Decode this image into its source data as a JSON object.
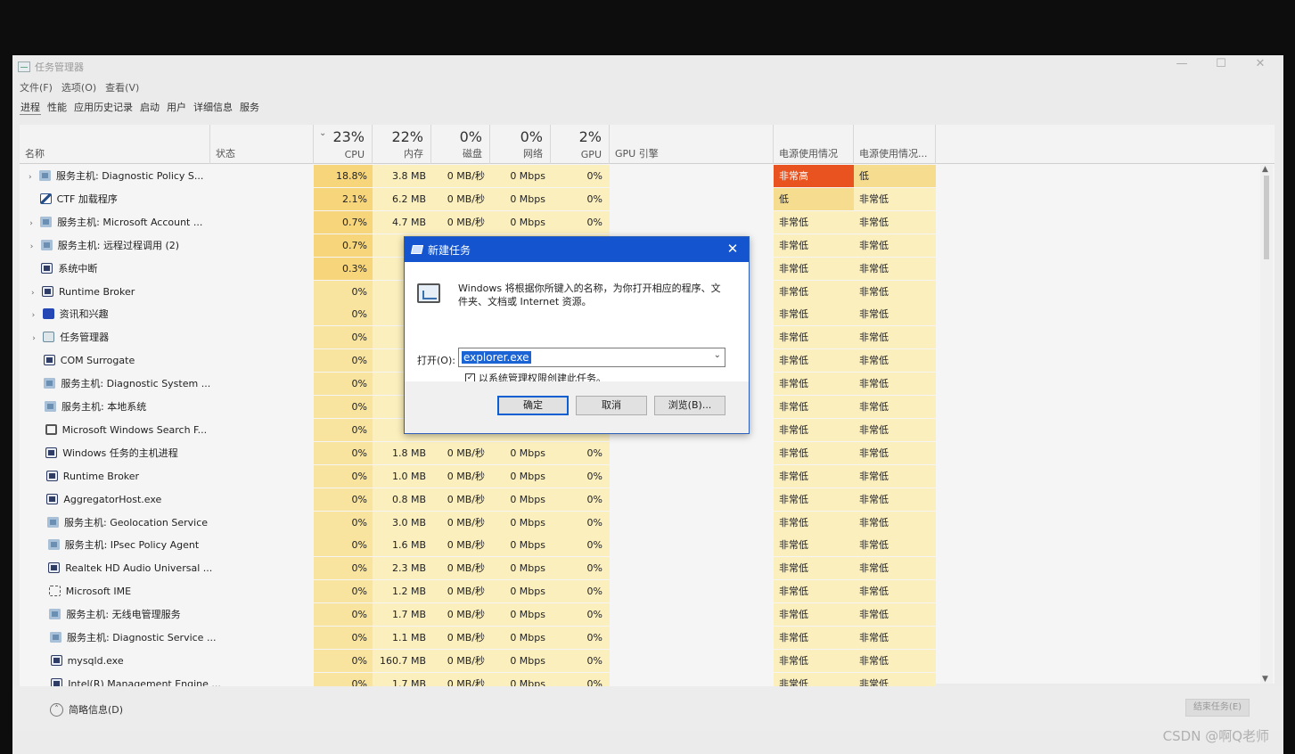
{
  "window": {
    "title": "任务管理器",
    "controls": [
      "—",
      "☐",
      "✕"
    ]
  },
  "menu": [
    "文件(F)",
    "选项(O)",
    "查看(V)"
  ],
  "tabs": [
    "进程",
    "性能",
    "应用历史记录",
    "启动",
    "用户",
    "详细信息",
    "服务"
  ],
  "columns": {
    "name": "名称",
    "status": "状态",
    "cpu": {
      "pct": "23%",
      "label": "CPU"
    },
    "mem": {
      "pct": "22%",
      "label": "内存"
    },
    "disk": {
      "pct": "0%",
      "label": "磁盘"
    },
    "net": {
      "pct": "0%",
      "label": "网络"
    },
    "gpu": {
      "pct": "2%",
      "label": "GPU"
    },
    "gpu_engine": "GPU 引擎",
    "power": "电源使用情况",
    "power_trend": "电源使用情况..."
  },
  "rows": [
    {
      "name": "服务主机: Diagnostic Policy S...",
      "exp": "›",
      "icon": "gear-icon",
      "cpu": "18.8%",
      "mem": "3.8 MB",
      "disk": "0 MB/秒",
      "net": "0 Mbps",
      "gpu": "0%",
      "pw": "非常高",
      "pw2": "低"
    },
    {
      "name": "CTF 加载程序",
      "exp": "",
      "icon": "pen-icon",
      "cpu": "2.1%",
      "mem": "6.2 MB",
      "disk": "0 MB/秒",
      "net": "0 Mbps",
      "gpu": "0%",
      "pw": "低",
      "pw2": "非常低"
    },
    {
      "name": "服务主机: Microsoft Account ...",
      "exp": "›",
      "icon": "gear-icon",
      "cpu": "0.7%",
      "mem": "4.7 MB",
      "disk": "0 MB/秒",
      "net": "0 Mbps",
      "gpu": "0%",
      "pw": "非常低",
      "pw2": "非常低"
    },
    {
      "name": "服务主机: 远程过程调用 (2)",
      "exp": "›",
      "icon": "gear-icon",
      "cpu": "0.7%",
      "mem": "5.",
      "disk": "",
      "net": "",
      "gpu": "",
      "pw": "非常低",
      "pw2": "非常低"
    },
    {
      "name": "系统中断",
      "exp": "",
      "icon": "window-icon",
      "cpu": "0.3%",
      "mem": "(",
      "disk": "",
      "net": "",
      "gpu": "",
      "pw": "非常低",
      "pw2": "非常低"
    },
    {
      "name": "Runtime Broker",
      "exp": "›",
      "icon": "window-icon",
      "cpu": "0%",
      "mem": "2.",
      "disk": "",
      "net": "",
      "gpu": "",
      "pw": "非常低",
      "pw2": "非常低"
    },
    {
      "name": "资讯和兴趣",
      "exp": "›",
      "icon": "news-icon",
      "cpu": "0%",
      "mem": "(",
      "disk": "",
      "net": "",
      "gpu": "",
      "pw": "非常低",
      "pw2": "非常低"
    },
    {
      "name": "任务管理器",
      "exp": "›",
      "icon": "task-manager-icon",
      "cpu": "0%",
      "mem": "23.",
      "disk": "",
      "net": "",
      "gpu": "",
      "pw": "非常低",
      "pw2": "非常低"
    },
    {
      "name": "COM Surrogate",
      "exp": "",
      "icon": "window-icon",
      "cpu": "0%",
      "mem": "1.",
      "disk": "",
      "net": "",
      "gpu": "",
      "pw": "非常低",
      "pw2": "非常低"
    },
    {
      "name": "服务主机: Diagnostic System ...",
      "exp": "",
      "icon": "gear-icon",
      "cpu": "0%",
      "mem": "1.",
      "disk": "",
      "net": "",
      "gpu": "",
      "pw": "非常低",
      "pw2": "非常低"
    },
    {
      "name": "服务主机: 本地系统",
      "exp": "",
      "icon": "gear-icon",
      "cpu": "0%",
      "mem": "1.",
      "disk": "",
      "net": "",
      "gpu": "",
      "pw": "非常低",
      "pw2": "非常低"
    },
    {
      "name": "Microsoft Windows Search F...",
      "exp": "",
      "icon": "search-icon",
      "cpu": "0%",
      "mem": "1.",
      "disk": "",
      "net": "",
      "gpu": "",
      "pw": "非常低",
      "pw2": "非常低"
    },
    {
      "name": "Windows 任务的主机进程",
      "exp": "",
      "icon": "window-icon",
      "cpu": "0%",
      "mem": "1.8 MB",
      "disk": "0 MB/秒",
      "net": "0 Mbps",
      "gpu": "0%",
      "pw": "非常低",
      "pw2": "非常低"
    },
    {
      "name": "Runtime Broker",
      "exp": "",
      "icon": "window-icon",
      "cpu": "0%",
      "mem": "1.0 MB",
      "disk": "0 MB/秒",
      "net": "0 Mbps",
      "gpu": "0%",
      "pw": "非常低",
      "pw2": "非常低"
    },
    {
      "name": "AggregatorHost.exe",
      "exp": "",
      "icon": "window-icon",
      "cpu": "0%",
      "mem": "0.8 MB",
      "disk": "0 MB/秒",
      "net": "0 Mbps",
      "gpu": "0%",
      "pw": "非常低",
      "pw2": "非常低"
    },
    {
      "name": "服务主机: Geolocation Service",
      "exp": "",
      "icon": "gear-icon",
      "cpu": "0%",
      "mem": "3.0 MB",
      "disk": "0 MB/秒",
      "net": "0 Mbps",
      "gpu": "0%",
      "pw": "非常低",
      "pw2": "非常低"
    },
    {
      "name": "服务主机: IPsec Policy Agent",
      "exp": "",
      "icon": "gear-icon",
      "cpu": "0%",
      "mem": "1.6 MB",
      "disk": "0 MB/秒",
      "net": "0 Mbps",
      "gpu": "0%",
      "pw": "非常低",
      "pw2": "非常低"
    },
    {
      "name": "Realtek HD Audio Universal ...",
      "exp": "",
      "icon": "window-icon",
      "cpu": "0%",
      "mem": "2.3 MB",
      "disk": "0 MB/秒",
      "net": "0 Mbps",
      "gpu": "0%",
      "pw": "非常低",
      "pw2": "非常低"
    },
    {
      "name": "Microsoft IME",
      "exp": "",
      "icon": "ime-icon",
      "cpu": "0%",
      "mem": "1.2 MB",
      "disk": "0 MB/秒",
      "net": "0 Mbps",
      "gpu": "0%",
      "pw": "非常低",
      "pw2": "非常低"
    },
    {
      "name": "服务主机: 无线电管理服务",
      "exp": "",
      "icon": "gear-icon",
      "cpu": "0%",
      "mem": "1.7 MB",
      "disk": "0 MB/秒",
      "net": "0 Mbps",
      "gpu": "0%",
      "pw": "非常低",
      "pw2": "非常低"
    },
    {
      "name": "服务主机: Diagnostic Service ...",
      "exp": "",
      "icon": "gear-icon",
      "cpu": "0%",
      "mem": "1.1 MB",
      "disk": "0 MB/秒",
      "net": "0 Mbps",
      "gpu": "0%",
      "pw": "非常低",
      "pw2": "非常低"
    },
    {
      "name": "mysqld.exe",
      "exp": "",
      "icon": "window-icon",
      "cpu": "0%",
      "mem": "160.7 MB",
      "disk": "0 MB/秒",
      "net": "0 Mbps",
      "gpu": "0%",
      "pw": "非常低",
      "pw2": "非常低"
    },
    {
      "name": "Intel(R) Management Engine ...",
      "exp": "",
      "icon": "window-icon",
      "cpu": "0%",
      "mem": "1.7 MB",
      "disk": "0 MB/秒",
      "net": "0 Mbps",
      "gpu": "0%",
      "pw": "非常低",
      "pw2": "非常低"
    }
  ],
  "footer": {
    "fewer_details": "简略信息(D)",
    "end_task": "结束任务(E)"
  },
  "watermark": "CSDN @啊Q老师",
  "dialog": {
    "title": "新建任务",
    "description": "Windows 将根据你所键入的名称，为你打开相应的程序、文件夹、文档或 Internet 资源。",
    "open_label": "打开(O):",
    "open_value": "explorer.exe",
    "admin_checkbox": "以系统管理权限创建此任务。",
    "admin_checked": true,
    "ok": "确定",
    "cancel": "取消",
    "browse": "浏览(B)..."
  },
  "colors": {
    "power_very_high": "#e8531f",
    "power_low": "#f5dc8e",
    "heat_cpu_high": "#f7d57a",
    "heat_cpu": "#f9e49f",
    "heat_light": "#fbefbd",
    "dialog_title": "#1455cf"
  }
}
